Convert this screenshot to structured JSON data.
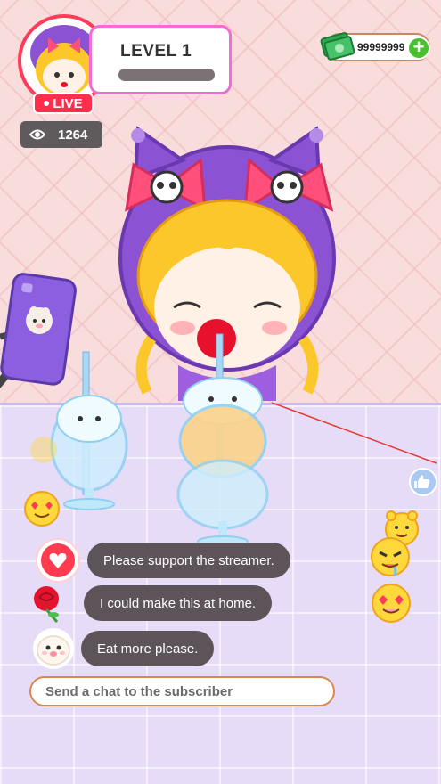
{
  "profile": {
    "level_label": "LEVEL 1",
    "level_progress": 0,
    "live_label": "LIVE",
    "viewers_count": "1264"
  },
  "currency": {
    "amount": "99999999",
    "add_label": "+"
  },
  "chat": {
    "messages": [
      {
        "text": "Please support the streamer.",
        "avatar": "heart-icon"
      },
      {
        "text": "I could make this at home.",
        "avatar": "rose-icon"
      },
      {
        "text": "Eat more please.",
        "avatar": "seal-icon"
      }
    ],
    "input_placeholder": "Send a chat to the subscriber"
  },
  "colors": {
    "live_red": "#ff2e4d",
    "level_border": "#f26bd6",
    "chat_bubble": "#5c5458",
    "cash_green": "#47c12e"
  }
}
